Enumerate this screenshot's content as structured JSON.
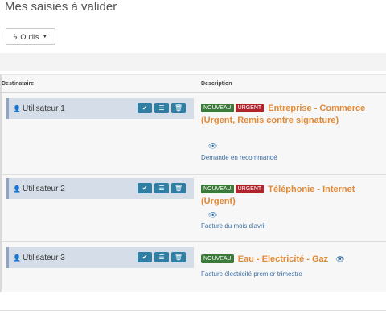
{
  "page": {
    "title": "Mes saisies à valider"
  },
  "toolbar": {
    "tools_label": "Outils"
  },
  "table": {
    "col_recipient": "Destinataire",
    "col_description": "Description"
  },
  "rows": [
    {
      "user": "Utilisateur 1",
      "badges": [
        "NOUVEAU",
        "URGENT"
      ],
      "subject": "Entreprise - Commerce (Urgent, Remis contre signature)",
      "note": "Demande en recommandé"
    },
    {
      "user": "Utilisateur 2",
      "badges": [
        "NOUVEAU",
        "URGENT"
      ],
      "subject": "Téléphonie - Internet (Urgent)",
      "note": "Facture du mois d'avril"
    },
    {
      "user": "Utilisateur 3",
      "badges": [
        "NOUVEAU"
      ],
      "subject": "Eau - Electricité - Gaz",
      "note": "Facture électricité premier trimestre"
    }
  ],
  "colors": {
    "accent_button": "#2f7fa5",
    "badge_new": "#3c7a3b",
    "badge_urgent": "#b1242d",
    "subject": "#e08a3a",
    "link": "#3a6ea5"
  },
  "icons": {
    "tools": "bolt-icon",
    "user": "user-icon",
    "validate": "check-icon",
    "details": "list-icon",
    "delete": "trash-icon",
    "preview": "eye-icon"
  }
}
